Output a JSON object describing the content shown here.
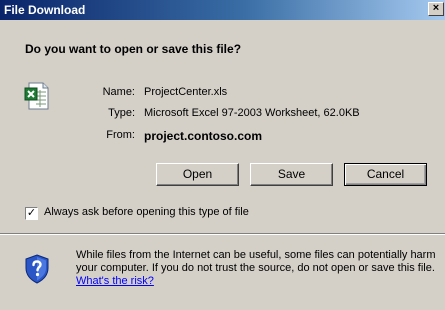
{
  "window": {
    "title": "File Download",
    "close_glyph": "×"
  },
  "prompt": {
    "question": "Do you want to open or save this file?"
  },
  "file": {
    "icon": "excel-file-icon",
    "name_label": "Name:",
    "name_value": "ProjectCenter.xls",
    "type_label": "Type:",
    "type_value": "Microsoft Excel 97-2003 Worksheet, 62.0KB",
    "from_label": "From:",
    "from_value": "project.contoso.com"
  },
  "buttons": {
    "open_label": "Open",
    "save_label": "Save",
    "cancel_label": "Cancel"
  },
  "always_ask": {
    "checked": true,
    "check_glyph": "✓",
    "label": "Always ask before opening this type of file"
  },
  "warning": {
    "icon": "shield-question-icon",
    "text": "While files from the Internet can be useful, some files can potentially harm your computer. If you do not trust the source, do not open or save this file.",
    "link_text": "What's the risk?"
  },
  "colors": {
    "dialog_bg": "#d4d0c8",
    "title_start": "#0a246a",
    "title_end": "#a6caf0",
    "link": "#0000ff"
  }
}
